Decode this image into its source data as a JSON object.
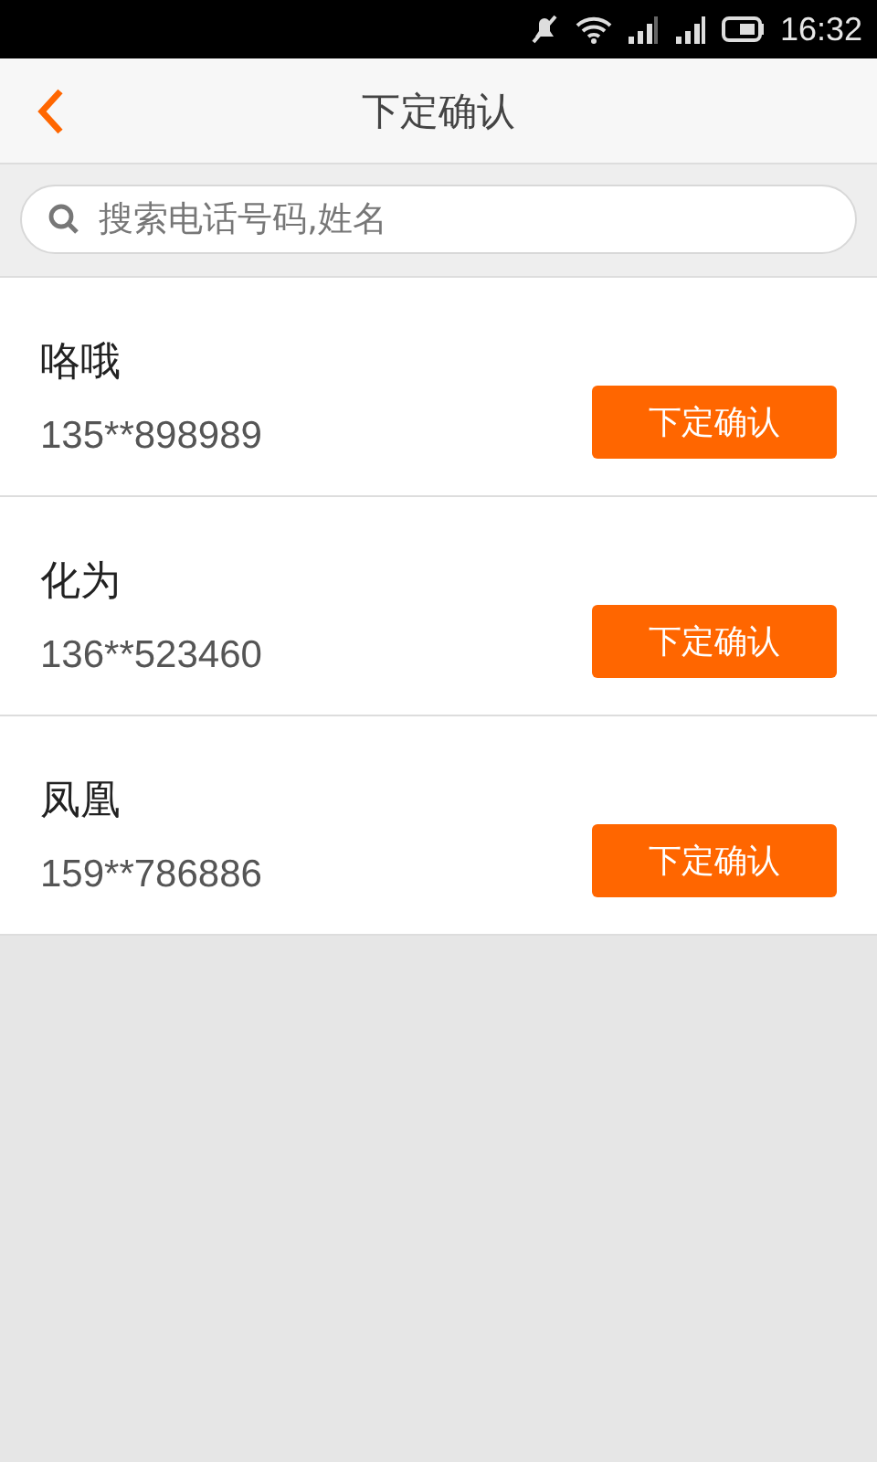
{
  "status_bar": {
    "time": "16:32"
  },
  "header": {
    "title": "下定确认"
  },
  "search": {
    "placeholder": "搜索电话号码,姓名"
  },
  "contacts": [
    {
      "name": "咯哦",
      "phone": "135**898989",
      "button": "下定确认"
    },
    {
      "name": "化为",
      "phone": "136**523460",
      "button": "下定确认"
    },
    {
      "name": "凤凰",
      "phone": "159**786886",
      "button": "下定确认"
    }
  ]
}
